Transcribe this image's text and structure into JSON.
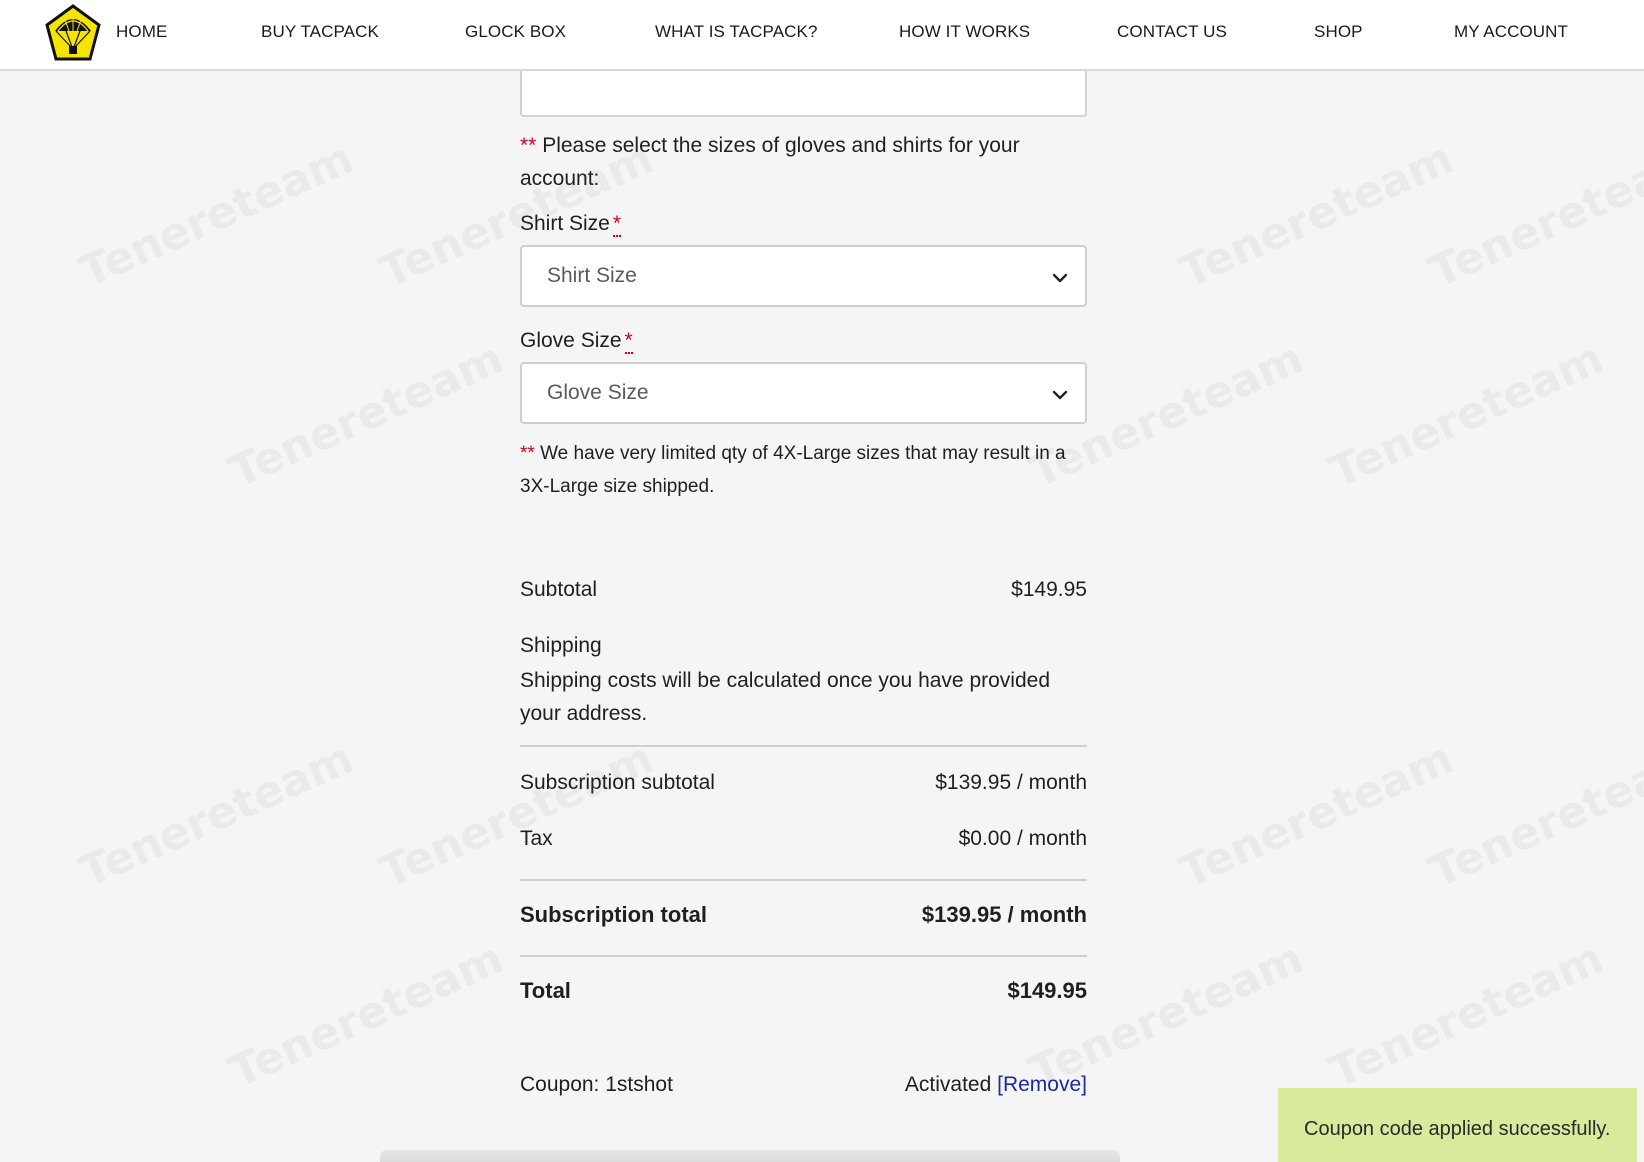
{
  "nav": {
    "items": [
      "HOME",
      "BUY TACPACK",
      "GLOCK BOX",
      "WHAT IS TACPACK?",
      "HOW IT WORKS",
      "CONTACT US",
      "SHOP",
      "MY ACCOUNT"
    ]
  },
  "form": {
    "size_note_stars": "**",
    "size_note": "Please select the sizes of gloves and shirts for your account:",
    "shirt_label": "Shirt Size",
    "shirt_placeholder": "Shirt Size",
    "glove_label": "Glove Size",
    "glove_placeholder": "Glove Size",
    "required_marker": "*",
    "limited_note_stars": "**",
    "limited_note": "We have very limited qty of 4X-Large sizes that may result in a 3X-Large size shipped."
  },
  "summary": {
    "subtotal_label": "Subtotal",
    "subtotal_value": "$149.95",
    "shipping_label": "Shipping",
    "shipping_note": "Shipping costs will be calculated once you have provided your address.",
    "sub_subtotal_label": "Subscription subtotal",
    "sub_subtotal_value": "$139.95 / month",
    "tax_label": "Tax",
    "tax_value": "$0.00 / month",
    "sub_total_label": "Subscription total",
    "sub_total_value": "$139.95 / month",
    "total_label": "Total",
    "total_value": "$149.95",
    "coupon_label": "Coupon: 1stshot",
    "coupon_status": "Activated",
    "coupon_remove": "[Remove]"
  },
  "toast": {
    "message": "Coupon code applied successfully."
  },
  "colors": {
    "required": "#d0021b",
    "link": "#1b2a9e",
    "toast_bg": "#d8ea9b",
    "logo_yellow": "#f5e400"
  },
  "icons": {
    "logo": "parachute-logo-icon",
    "select_chevron": "chevron-down-icon"
  },
  "watermark": "Tenereteam"
}
